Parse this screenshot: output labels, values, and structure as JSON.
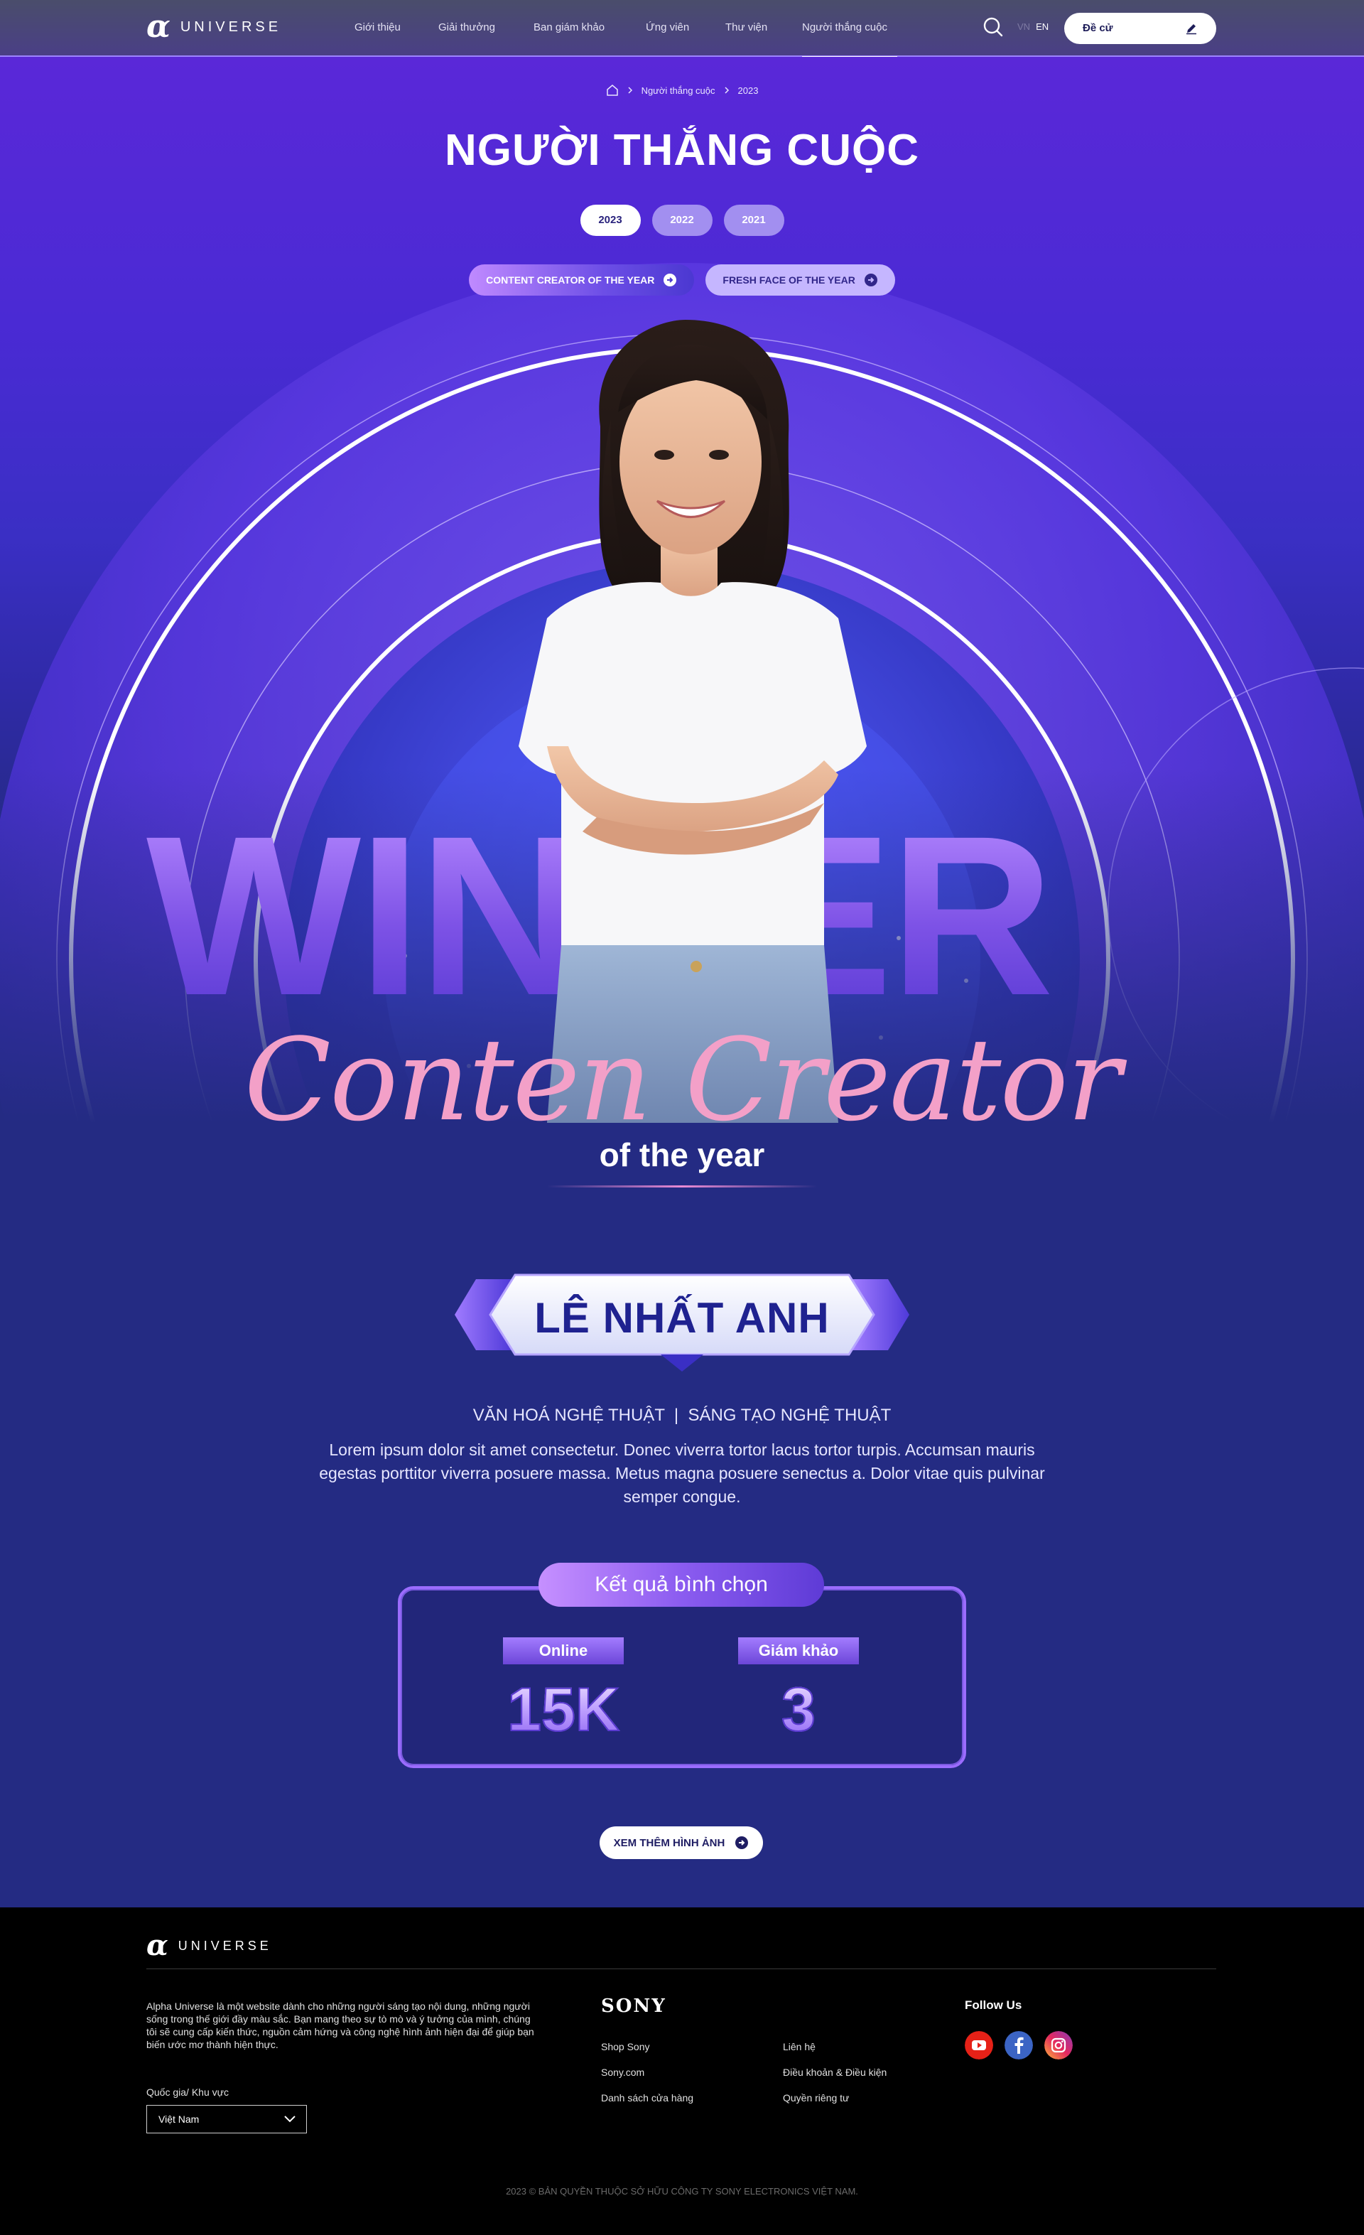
{
  "header": {
    "brand": "UNIVERSE",
    "nav": [
      {
        "label": "Giới thiệu"
      },
      {
        "label": "Giải thưởng"
      },
      {
        "label": "Ban giám khảo"
      },
      {
        "label": "Ứng viên"
      },
      {
        "label": "Thư viện"
      },
      {
        "label": "Người thắng cuộc",
        "active": true
      }
    ],
    "lang_vn": "VN",
    "lang_en": "EN",
    "nominate_label": "Đề cử"
  },
  "breadcrumb": [
    "Người thắng cuộc",
    "2023"
  ],
  "page_title": "NGƯỜI THẮNG CUỘC",
  "years": [
    "2023",
    "2022",
    "2021"
  ],
  "active_year": "2023",
  "categories": [
    "CONTENT CREATOR OF THE YEAR",
    "FRESH FACE OF THE YEAR"
  ],
  "hero": {
    "big_word": "WINNER",
    "script_text": "Conten Creator",
    "of_year": "of the year"
  },
  "winner": {
    "name": "LÊ NHẤT ANH",
    "fields": "VĂN HOÁ NGHỆ THUẬT  |  SÁNG TẠO NGHỆ THUẬT",
    "description": "Lorem ipsum dolor sit amet consectetur. Donec viverra tortor lacus tortor turpis. Accumsan mauris egestas porttitor viverra posuere massa. Metus magna posuere senectus a. Dolor vitae quis pulvinar semper congue."
  },
  "results": {
    "title": "Kết quả bình chọn",
    "online_label": "Online",
    "online_value": "15K",
    "judges_label": "Giám khảo",
    "judges_value": "3"
  },
  "more_button": "XEM THÊM HÌNH ẢNH",
  "footer": {
    "brand": "UNIVERSE",
    "about": "Alpha Universe là một website dành cho những người sáng tạo nội dung, những người sống trong thế giới đầy màu sắc. Bạn mang theo sự tò mò và ý tưởng của mình, chúng tôi sẽ cung cấp kiến thức, nguồn cảm hứng và công nghệ hình ảnh hiện đại để giúp bạn biến ước mơ thành hiện thực.",
    "region_label": "Quốc gia/ Khu vực",
    "region_value": "Việt Nam",
    "sony": "SONY",
    "links_col1": [
      "Shop Sony",
      "Sony.com",
      "Danh sách cửa hàng"
    ],
    "links_col2": [
      "Liên hệ",
      "Điều khoản & Điều kiện",
      "Quyền riêng tư"
    ],
    "follow": "Follow Us",
    "socials": [
      "youtube-icon",
      "facebook-icon",
      "instagram-icon"
    ],
    "copyright": "2023 © BẢN QUYỀN THUỘC SỞ HỮU CÔNG TY SONY ELECTRONICS VIỆT NAM."
  },
  "colors": {
    "accent": "#5a28d8",
    "page_bg": "#242b83",
    "name_color": "#1f2290",
    "script_pink": "#f3a0c8"
  }
}
